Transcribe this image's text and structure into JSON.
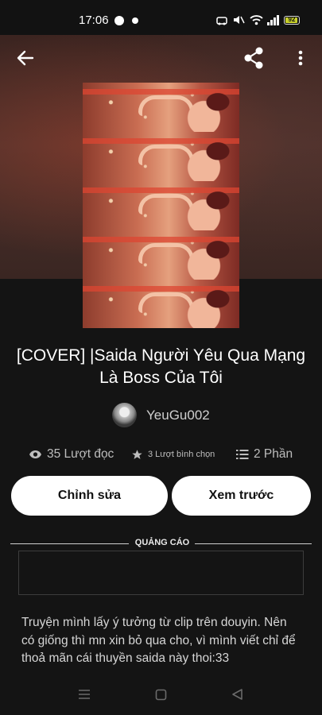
{
  "status_bar": {
    "time": "17:06",
    "battery": "92",
    "icons": [
      "messenger-icon",
      "notification-dot-icon",
      "alarm-icon",
      "mute-icon",
      "wifi-icon",
      "signal-icon",
      "battery-icon"
    ]
  },
  "header": {
    "back_icon": "arrow-back-icon",
    "share_icon": "share-icon",
    "more_icon": "more-vert-icon"
  },
  "story": {
    "title": "[COVER] |Saida Người Yêu Qua Mạng Là Boss Của Tôi",
    "author": "YeuGu002",
    "stats": {
      "reads": "35 Lượt đọc",
      "votes": "3 Lượt bình chọn",
      "parts": "2 Phần"
    },
    "description": "Truyện mình lấy ý tưởng từ clip trên douyin. Nên có giống thì mn xin bỏ qua cho, vì mình viết chỉ để thoả mãn cái thuyền saida này thoi:33"
  },
  "actions": {
    "edit_label": "Chỉnh sửa",
    "preview_label": "Xem trước"
  },
  "ad": {
    "label": "QUẢNG CÁO"
  },
  "colors": {
    "background": "#141414",
    "button_bg": "#ffffff",
    "battery_accent": "#c9d12b"
  }
}
